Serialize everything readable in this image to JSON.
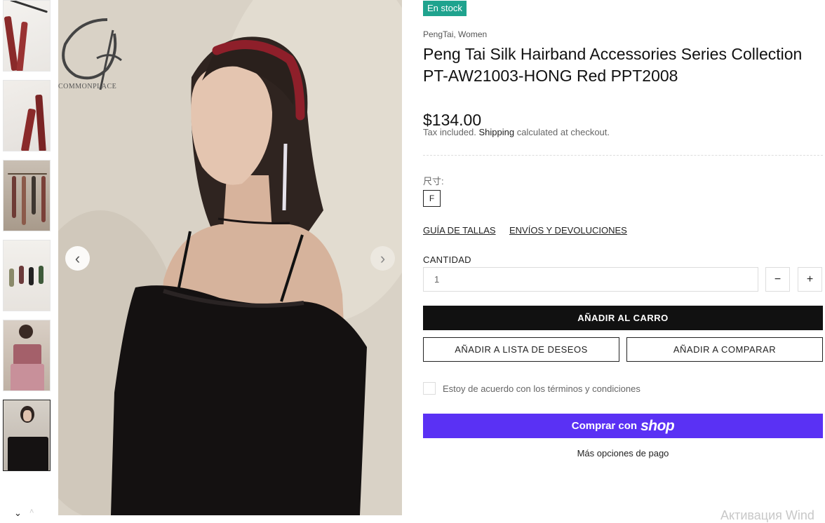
{
  "gallery": {
    "thumbnails": [
      {
        "alt": "hairband detail 1"
      },
      {
        "alt": "hairband detail 2"
      },
      {
        "alt": "hair accessories on hanger"
      },
      {
        "alt": "hair ties on display"
      },
      {
        "alt": "model in pink dress"
      },
      {
        "alt": "model in black top"
      }
    ],
    "active_index": 5,
    "logo_text": "COMMONPLACE",
    "prev_icon": "‹",
    "next_icon": "›",
    "thumb_down_icon": "⌄",
    "thumb_up_icon": "˄"
  },
  "product": {
    "stock_badge": "En stock",
    "vendor": "PengTai, Women",
    "title": "Peng Tai Silk Hairband Accessories Series Collection PT-AW21003-HONG Red PPT2008",
    "price": "$134.00",
    "tax_prefix": "Tax included.",
    "tax_link": "Shipping",
    "tax_suffix": "calculated at checkout.",
    "option_label": "尺寸:",
    "size_value": "F",
    "size_guide_link": "GUÍA DE TALLAS",
    "shipping_link": "ENVÍOS Y DEVOLUCIONES",
    "quantity_label": "CANTIDAD",
    "quantity_value": "1",
    "minus_label": "−",
    "plus_label": "+",
    "add_to_cart": "AÑADIR AL CARRO",
    "add_to_wishlist": "AÑADIR A LISTA DE DESEOS",
    "add_to_compare": "AÑADIR A COMPARAR",
    "terms_label": "Estoy de acuerdo con los términos y condiciones",
    "shop_pay_label": "Comprar con",
    "shop_pay_logo": "shop",
    "more_payment": "Más opciones de pago"
  },
  "colors": {
    "badge": "#1fa38e",
    "cart_button": "#111111",
    "shop_pay": "#5a31f4"
  },
  "watermark": "Активация Wind"
}
